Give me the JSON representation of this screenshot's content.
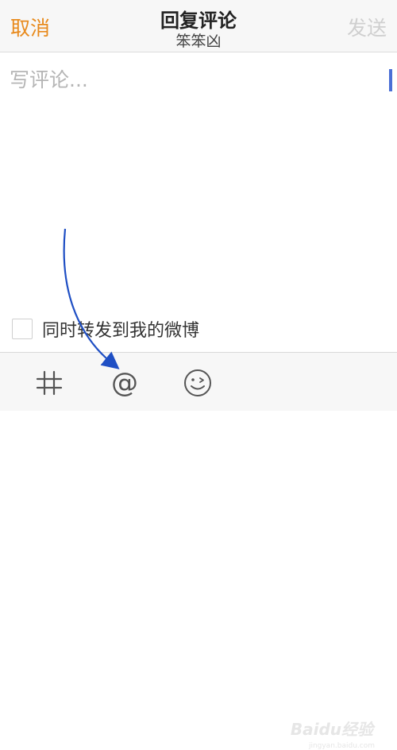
{
  "header": {
    "cancel_label": "取消",
    "title": "回复评论",
    "subtitle": "笨笨凶",
    "send_label": "发送"
  },
  "comment": {
    "placeholder": "写评论...",
    "value": ""
  },
  "repost": {
    "label": "同时转发到我的微博",
    "checked": false
  },
  "toolbar": {
    "items": [
      {
        "name": "hashtag-icon"
      },
      {
        "name": "at-mention-icon",
        "glyph": "@"
      },
      {
        "name": "emoji-icon"
      }
    ]
  },
  "watermark": {
    "text": "Baidu经验",
    "sub": "jingyan.baidu.com"
  },
  "colors": {
    "accent": "#e88a1c",
    "send_disabled": "#cfcfcf",
    "caret": "#4a6fd6",
    "annotation_arrow": "#1f4fc4"
  }
}
